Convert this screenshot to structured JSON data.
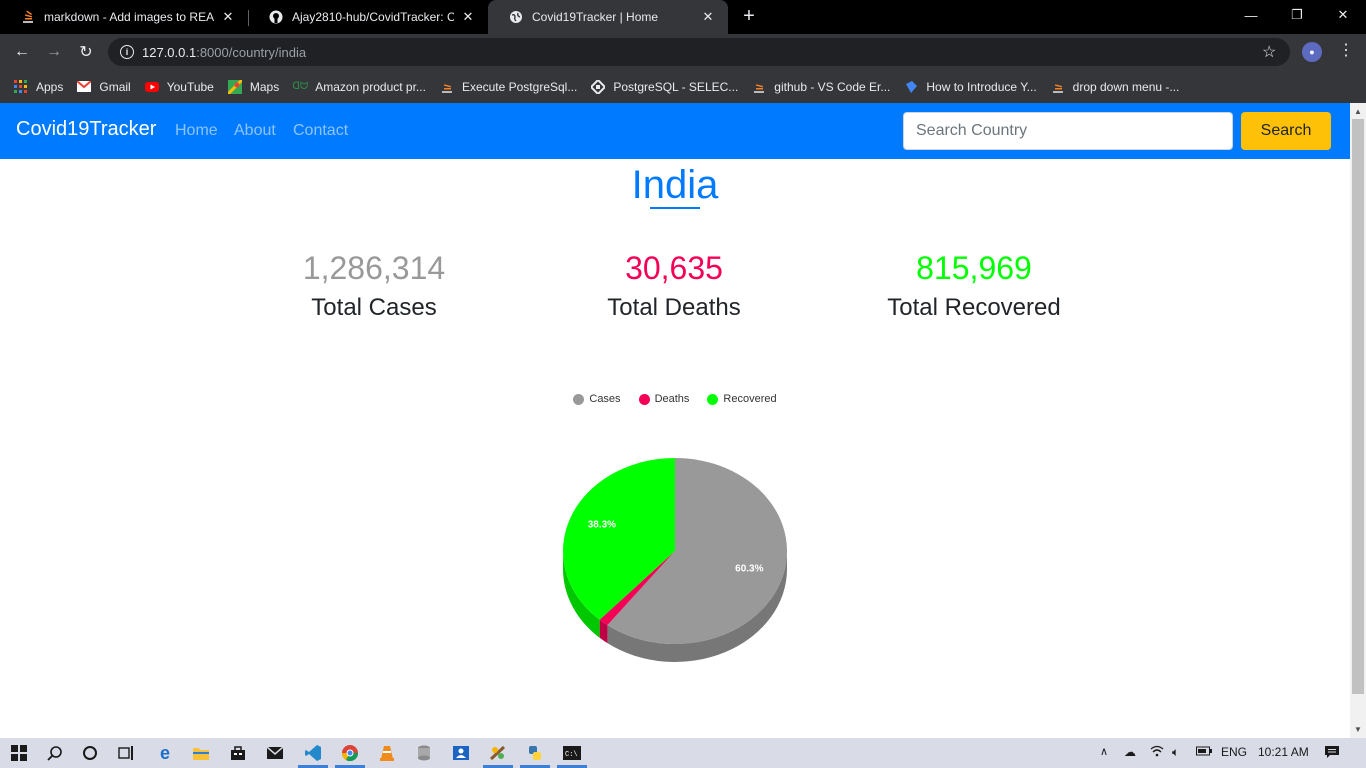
{
  "browser": {
    "tabs": [
      {
        "title": "markdown - Add images to READ",
        "icon": "stackoverflow-icon"
      },
      {
        "title": "Ajay2810-hub/CovidTracker: Covi",
        "icon": "github-icon"
      },
      {
        "title": "Covid19Tracker | Home",
        "icon": "globe-icon"
      }
    ],
    "active_tab": 2,
    "url_host": "127.0.0.1",
    "url_path": ":8000/country/india",
    "bookmarks": [
      {
        "label": "Apps",
        "icon": "apps-grid-icon"
      },
      {
        "label": "Gmail",
        "icon": "gmail-icon"
      },
      {
        "label": "YouTube",
        "icon": "youtube-icon"
      },
      {
        "label": "Maps",
        "icon": "maps-icon"
      },
      {
        "label": "Amazon product pr...",
        "icon": "geeksforgeeks-icon"
      },
      {
        "label": "Execute PostgreSql...",
        "icon": "stackoverflow-icon"
      },
      {
        "label": "PostgreSQL - SELEC...",
        "icon": "tutorial-icon"
      },
      {
        "label": "github - VS Code Er...",
        "icon": "stackoverflow-icon"
      },
      {
        "label": "How to Introduce Y...",
        "icon": "bookmark-icon"
      },
      {
        "label": "drop down menu -...",
        "icon": "stackoverflow-icon"
      }
    ]
  },
  "navbar": {
    "brand": "Covid19Tracker",
    "links": [
      "Home",
      "About",
      "Contact"
    ],
    "search_placeholder": "Search Country",
    "search_button": "Search"
  },
  "country": "India",
  "stats": [
    {
      "value": "1,286,314",
      "label": "Total Cases",
      "color": "#999999"
    },
    {
      "value": "30,635",
      "label": "Total Deaths",
      "color": "#f50057"
    },
    {
      "value": "815,969",
      "label": "Total Recovered",
      "color": "#00ff00"
    }
  ],
  "chart_data": {
    "type": "pie",
    "title": "",
    "categories": [
      "Cases",
      "Deaths",
      "Recovered"
    ],
    "values": [
      1286314,
      30635,
      815969
    ],
    "data_labels": [
      "60.3%",
      "",
      "38.3%"
    ],
    "colors": [
      "#999999",
      "#f50057",
      "#00ff00"
    ],
    "legend_position": "top",
    "is_3d": true
  },
  "taskbar": {
    "time": "10:21 AM",
    "language": "ENG"
  }
}
